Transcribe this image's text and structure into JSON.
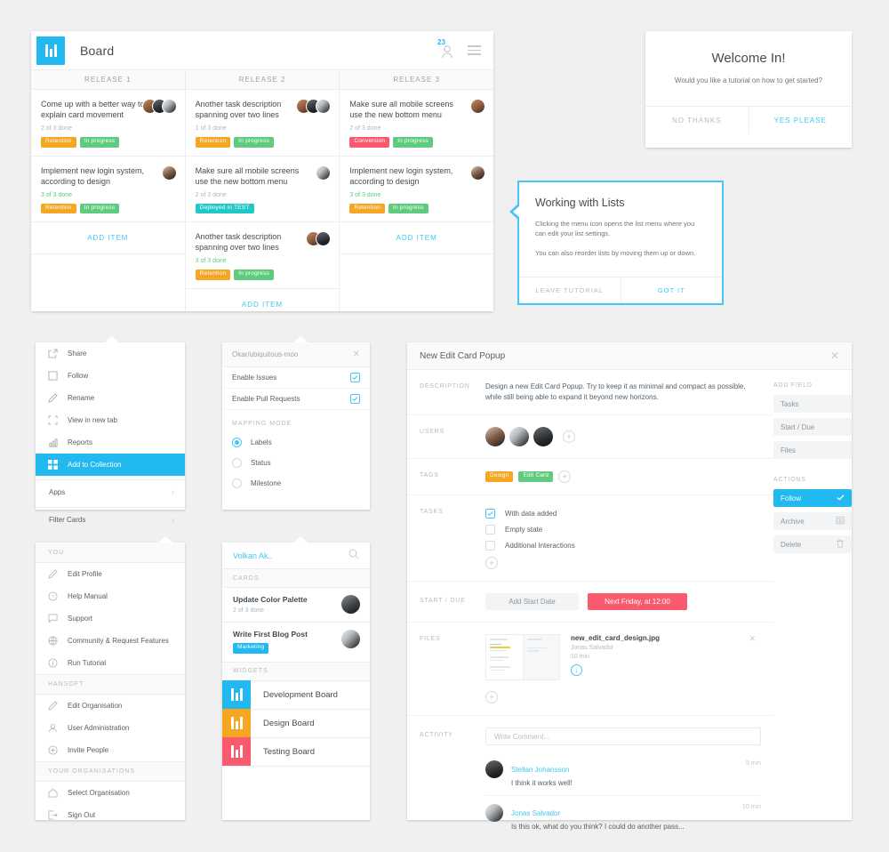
{
  "board": {
    "title": "Board",
    "notification_count": "23",
    "columns": [
      {
        "header": "RELEASE 1",
        "add_item": "ADD ITEM",
        "cards": [
          {
            "title": "Come up with a better way to explain card movement",
            "progress": "2 of 3 done",
            "complete": false,
            "tags": [
              {
                "label": "Retention",
                "color": "#f5a623"
              },
              {
                "label": "In progress",
                "color": "#5ecb7e"
              }
            ],
            "avatars": [
              "fa1",
              "fa3",
              "fa5"
            ]
          },
          {
            "title": "Implement new login system, according to design",
            "progress": "3 of 3 done",
            "complete": true,
            "tags": [
              {
                "label": "Retention",
                "color": "#f5a623"
              },
              {
                "label": "In progress",
                "color": "#5ecb7e"
              }
            ],
            "avatars": [
              "fa4"
            ]
          }
        ]
      },
      {
        "header": "RELEASE 2",
        "add_item": "ADD ITEM",
        "cards": [
          {
            "title": "Another task description spanning over two lines",
            "progress": "1 of 3 done",
            "complete": false,
            "tags": [
              {
                "label": "Retention",
                "color": "#f5a623"
              },
              {
                "label": "In progress",
                "color": "#5ecb7e"
              }
            ],
            "avatars": [
              "fa1",
              "fa3",
              "fa5"
            ]
          },
          {
            "title": "Make sure all mobile screens use the new bottom menu",
            "progress": "2 of 3 done",
            "complete": false,
            "tags": [
              {
                "label": "Deployed in TEST",
                "color": "#22c7c7"
              }
            ],
            "avatars": [
              "fa5"
            ]
          },
          {
            "title": "Another task description spanning over two lines",
            "progress": "3 of 3 done",
            "complete": true,
            "tags": [
              {
                "label": "Retention",
                "color": "#f5a623"
              },
              {
                "label": "In progress",
                "color": "#5ecb7e"
              }
            ],
            "avatars": [
              "fa1",
              "fa3"
            ]
          }
        ]
      },
      {
        "header": "RELEASE 3",
        "add_item": "ADD ITEM",
        "cards": [
          {
            "title": "Make sure all mobile screens use the new bottom menu",
            "progress": "2 of 3 done",
            "complete": false,
            "tags": [
              {
                "label": "Conversion",
                "color": "#fa5a6e"
              },
              {
                "label": "In progress",
                "color": "#5ecb7e"
              }
            ],
            "avatars": [
              "fa1"
            ]
          },
          {
            "title": "Implement new login system, according to design",
            "progress": "3 of 3 done",
            "complete": true,
            "tags": [
              {
                "label": "Retention",
                "color": "#f5a623"
              },
              {
                "label": "In progress",
                "color": "#5ecb7e"
              }
            ],
            "avatars": [
              "fa4"
            ]
          }
        ]
      }
    ]
  },
  "welcome": {
    "title": "Welcome In!",
    "subtitle": "Would you like a tutorial on how to get started?",
    "decline": "NO THANKS",
    "accept": "YES PLEASE"
  },
  "tutorial": {
    "title": "Working with Lists",
    "paragraph1": "Clicking the menu icon opens the list menu where you can edit your list settings.",
    "paragraph2": "You can also reorder lists by moving them up or down.",
    "leave": "LEAVE TUTORIAL",
    "confirm": "GOT IT"
  },
  "list_menu": {
    "items": [
      {
        "label": "Share",
        "icon": "share-icon"
      },
      {
        "label": "Follow",
        "icon": "square-icon"
      },
      {
        "label": "Rename",
        "icon": "pencil-icon"
      },
      {
        "label": "View in new tab",
        "icon": "expand-icon"
      },
      {
        "label": "Reports",
        "icon": "bar-chart-icon"
      },
      {
        "label": "Add to Collection",
        "icon": "grid-icon",
        "selected": true
      }
    ],
    "sub_items": [
      {
        "label": "Apps"
      },
      {
        "label": "Filter Cards"
      }
    ]
  },
  "repo_menu": {
    "title": "Okar/ubiquitous-moo",
    "toggles": [
      {
        "label": "Enable Issues",
        "checked": true
      },
      {
        "label": "Enable Pull Requests",
        "checked": true
      }
    ],
    "section": "MAPPING MODE",
    "options": [
      {
        "label": "Labels",
        "selected": true
      },
      {
        "label": "Status",
        "selected": false
      },
      {
        "label": "Milestone",
        "selected": false
      }
    ]
  },
  "account_menu": {
    "sections": [
      {
        "header": "YOU",
        "items": [
          {
            "label": "Edit Profile",
            "icon": "pencil-icon"
          },
          {
            "label": "Help Manual",
            "icon": "question-circle-icon"
          },
          {
            "label": "Support",
            "icon": "chat-bubble-icon"
          },
          {
            "label": "Community & Request Features",
            "icon": "globe-icon"
          },
          {
            "label": "Run Tutorial",
            "icon": "info-circle-icon"
          }
        ]
      },
      {
        "header": "HANSOFT",
        "items": [
          {
            "label": "Edit Organisation",
            "icon": "pencil-icon"
          },
          {
            "label": "User Administration",
            "icon": "user-icon"
          },
          {
            "label": "Invite People",
            "icon": "plus-circle-icon"
          }
        ]
      },
      {
        "header": "YOUR ORGANISATIONS",
        "items": [
          {
            "label": "Select Organisation",
            "icon": "home-icon"
          },
          {
            "label": "Sign Out",
            "icon": "sign-out-icon"
          }
        ]
      }
    ]
  },
  "search_menu": {
    "query": "Volkan Ak..",
    "cards_header": "CARDS",
    "cards": [
      {
        "title": "Update Color Palette",
        "sub": "2 of 3 done",
        "tag": null,
        "avatar": "fa6"
      },
      {
        "title": "Write First Blog Post",
        "sub": null,
        "tag": {
          "label": "Marketing",
          "color": "#22b8f0"
        },
        "avatar": "fa5"
      }
    ],
    "widgets_header": "WIDGETS",
    "widgets": [
      {
        "label": "Development Board",
        "color": "#22b8f0"
      },
      {
        "label": "Design Board",
        "color": "#f5a623"
      },
      {
        "label": "Testing Board",
        "color": "#fa5a6e"
      }
    ]
  },
  "popup": {
    "title": "New Edit Card Popup",
    "labels": {
      "description": "DESCRIPTION",
      "users": "USERS",
      "tags": "TAGS",
      "tasks": "TASKS",
      "start_due": "START / DUE",
      "files": "FILES",
      "activity": "ACTIVITY"
    },
    "description": "Design a new Edit Card Popup. Try to keep it as minimal and compact as possible, while still being able to expand it beyond new horizons.",
    "users": [
      "fa4",
      "fa5",
      "fa3"
    ],
    "tags": [
      {
        "label": "Design",
        "color": "#f5a623"
      },
      {
        "label": "Edit Card",
        "color": "#5ecb7e"
      }
    ],
    "tasks": [
      {
        "label": "With data added",
        "checked": true
      },
      {
        "label": "Empty state",
        "checked": false
      },
      {
        "label": "Additional Interactions",
        "checked": false
      }
    ],
    "start_button": "Add Start Date",
    "due_button": "Next Friday, at 12:00",
    "file": {
      "name": "new_edit_card_design.jpg",
      "author": "Jonas Salvador",
      "time": "10 min"
    },
    "comment_placeholder": "Write Comment...",
    "comments": [
      {
        "author": "Stellan Johansson",
        "text": "I think it works well!",
        "time": "5 min",
        "avatar": "fa3"
      },
      {
        "author": "Jonas Salvador",
        "text": "Is this ok, what do you think? I could do another pass...",
        "time": "10 min",
        "avatar": "fa5"
      }
    ],
    "sidebar": {
      "add_field_label": "ADD FIELD",
      "add_fields": [
        {
          "label": "Tasks"
        },
        {
          "label": "Start / Due"
        },
        {
          "label": "Files"
        }
      ],
      "actions_label": "ACTIONS",
      "actions": [
        {
          "label": "Follow",
          "icon": "check-icon",
          "active": true
        },
        {
          "label": "Archive",
          "icon": "archive-icon",
          "active": false
        },
        {
          "label": "Delete",
          "icon": "trash-icon",
          "active": false
        }
      ]
    }
  },
  "colors": {
    "accent": "#22b8f0",
    "link": "#45c6f5",
    "orange": "#f5a623",
    "green": "#5ecb7e",
    "red": "#fa5a6e",
    "teal": "#22c7c7"
  }
}
